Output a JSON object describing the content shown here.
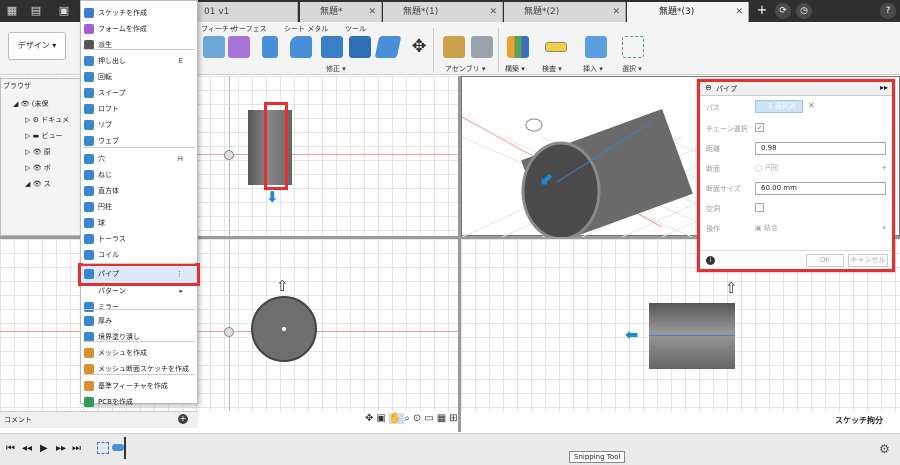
{
  "topbar": {
    "doc_tabs": [
      {
        "label": "01 v1",
        "active": false
      },
      {
        "label": "無題*",
        "active": false
      },
      {
        "label": "無題*(1)",
        "active": false
      },
      {
        "label": "無題*(2)",
        "active": false
      },
      {
        "label": "無題*(3)",
        "active": true
      }
    ]
  },
  "toolbar": {
    "workspace": "デザイン ▾",
    "sections": [
      "フィーチャ",
      "サーフェス",
      "シート メタル",
      "ツール"
    ],
    "groups": [
      "修正 ▾",
      "アセンブリ ▾",
      "構築 ▾",
      "検査 ▾",
      "挿入 ▾",
      "選択 ▾"
    ]
  },
  "menu": {
    "items": [
      {
        "label": "スケッチを作成",
        "shortcut": "",
        "icon": "sketch-icon"
      },
      {
        "label": "フォームを作成",
        "shortcut": "",
        "icon": "form-icon"
      },
      {
        "label": "派生",
        "shortcut": "",
        "icon": "derive-icon"
      },
      {
        "label": "押し出し",
        "shortcut": "E",
        "icon": "extrude-icon"
      },
      {
        "label": "回転",
        "shortcut": "",
        "icon": "revolve-icon"
      },
      {
        "label": "スイープ",
        "shortcut": "",
        "icon": "sweep-icon"
      },
      {
        "label": "ロフト",
        "shortcut": "",
        "icon": "loft-icon"
      },
      {
        "label": "リブ",
        "shortcut": "",
        "icon": "rib-icon"
      },
      {
        "label": "ウェブ",
        "shortcut": "",
        "icon": "web-icon"
      },
      {
        "label": "穴",
        "shortcut": "H",
        "icon": "hole-icon"
      },
      {
        "label": "ねじ",
        "shortcut": "",
        "icon": "thread-icon"
      },
      {
        "label": "直方体",
        "shortcut": "",
        "icon": "box-icon"
      },
      {
        "label": "円柱",
        "shortcut": "",
        "icon": "cylinder-icon"
      },
      {
        "label": "球",
        "shortcut": "",
        "icon": "sphere-icon"
      },
      {
        "label": "トーラス",
        "shortcut": "",
        "icon": "torus-icon"
      },
      {
        "label": "コイル",
        "shortcut": "",
        "icon": "coil-icon"
      },
      {
        "label": "パイプ",
        "shortcut": "⋮",
        "icon": "pipe-icon"
      },
      {
        "label": "パターン",
        "shortcut": "▸",
        "icon": ""
      },
      {
        "label": "ミラー",
        "shortcut": "",
        "icon": "mirror-icon"
      },
      {
        "label": "厚み",
        "shortcut": "",
        "icon": "thicken-icon"
      },
      {
        "label": "境界塗り潰し",
        "shortcut": "",
        "icon": "boundary-fill-icon"
      },
      {
        "label": "メッシュを作成",
        "shortcut": "",
        "icon": "mesh-icon"
      },
      {
        "label": "メッシュ断面スケッチを作成",
        "shortcut": "",
        "icon": "mesh-section-icon"
      },
      {
        "label": "基準フィーチャを作成",
        "shortcut": "",
        "icon": "base-feature-icon"
      },
      {
        "label": "PCBを作成",
        "shortcut": "",
        "icon": "pcb-icon"
      }
    ]
  },
  "browser": {
    "title": "ブラウザ",
    "items": [
      "(未保",
      "ドキュメ",
      "ビュー",
      "原",
      "ボ",
      "ス"
    ]
  },
  "dialog": {
    "title": "パイプ",
    "path_label": "パス",
    "path_value": "1 選択済み",
    "chain_label": "チェーン選択",
    "distance_label": "距離",
    "distance_value": "0.98",
    "section_label": "断面",
    "section_value": "円形",
    "section_size_label": "断面サイズ",
    "section_size_value": "60.00 mm",
    "hollow_label": "空洞",
    "operation_label": "操作",
    "operation_value": "結合",
    "ok": "OK",
    "cancel": "キャンセル"
  },
  "comment": {
    "label": "コメント"
  },
  "status": {
    "sketch_label": "スケッチ拘分"
  },
  "tooltip": {
    "label": "Snipping Tool"
  }
}
